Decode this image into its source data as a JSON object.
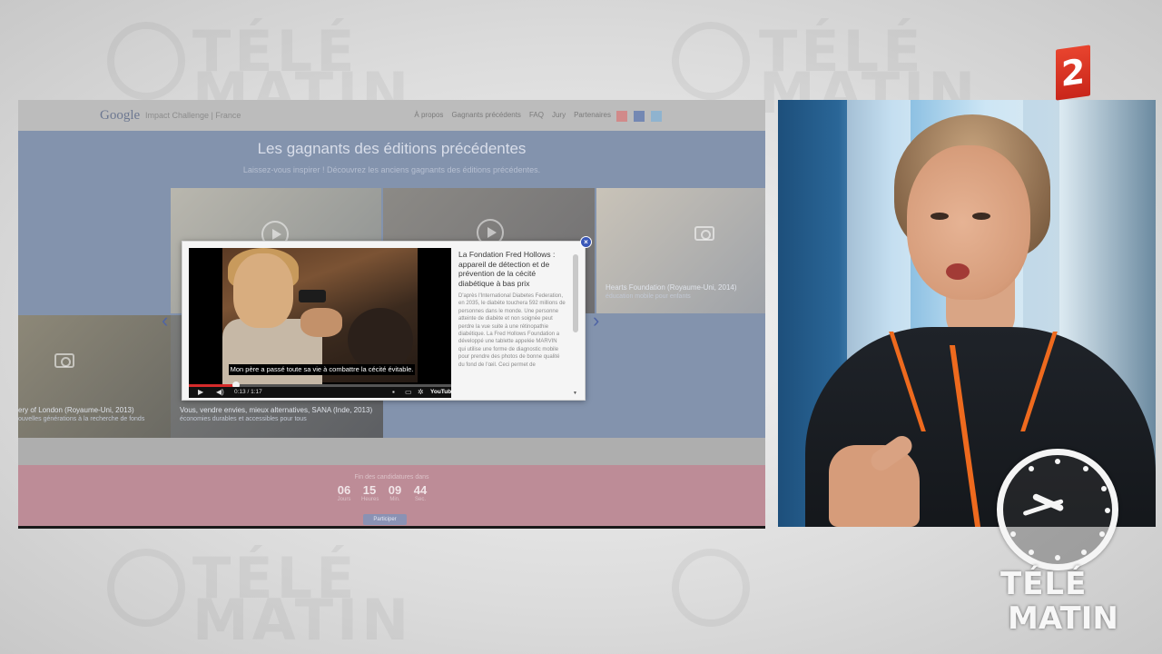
{
  "backdrop": {
    "words": [
      "TÉLÉ",
      "MATIN",
      "TÉLÉ",
      "MATIN",
      "TÉLÉ",
      "MATIN"
    ]
  },
  "website": {
    "logo": "Google",
    "logo_sub": "Impact Challenge | France",
    "nav": [
      "À propos",
      "Gagnants précédents",
      "FAQ",
      "Jury",
      "Partenaires"
    ],
    "section_title": "Les gagnants des éditions précédentes",
    "section_sub": "Laissez-vous inspirer ! Découvrez les anciens gagnants des éditions précédentes.",
    "tiles": [
      {
        "caption": "ery of London (Royaume-Uni, 2013)",
        "desc": "ouvelles générations à la recherche de fonds"
      },
      {
        "caption": "Vous, vendre envies, mieux alternatives, SANA (Inde, 2013)",
        "desc": "économies durables et accessibles pour tous"
      },
      {
        "caption": "Hearts Foundation (Royaume-Uni, 2014)",
        "desc": "éducation mobile pour enfants"
      }
    ],
    "countdown": {
      "label": "Fin des candidatures dans",
      "values": [
        "06",
        "15",
        "09",
        "44"
      ],
      "units": [
        "Jours",
        "Heures",
        "Min.",
        "Sec."
      ],
      "button": "Participer"
    },
    "colors": {
      "page_bg": "#8393ad",
      "header_bg": "#bcbcbc",
      "pink_band": "#bd8c97",
      "accent_blue": "#3a58b8"
    }
  },
  "modal": {
    "close_label": "×",
    "video": {
      "subtitle": "Mon père a passé toute sa vie à combattre la cécité évitable.",
      "time_current": "0:13",
      "time_total": "1:17",
      "progress": 0.18,
      "play_icon": "play-icon",
      "volume_icon": "volume-icon",
      "yt_label": "YouTube"
    },
    "title": "La Fondation Fred Hollows : appareil de détection et de prévention de la cécité diabétique à bas prix",
    "body": "D'après l'International Diabetes Federation, en 2035, le diabète touchera 592 millions de personnes dans le monde. Une personne atteinte de diabète et non soignée peut perdre la vue suite à une rétinopathie diabétique. La Fred Hollows Foundation a développé une tablette appelée MARVIN qui utilise une forme de diagnostic mobile pour prendre des photos de bonne qualité du fond de l'œil. Ceci permet de"
  },
  "channel": {
    "number": "2",
    "color": "#d7321f"
  },
  "show_logo": {
    "line1": "TÉLÉ",
    "line2": "MATIN"
  }
}
